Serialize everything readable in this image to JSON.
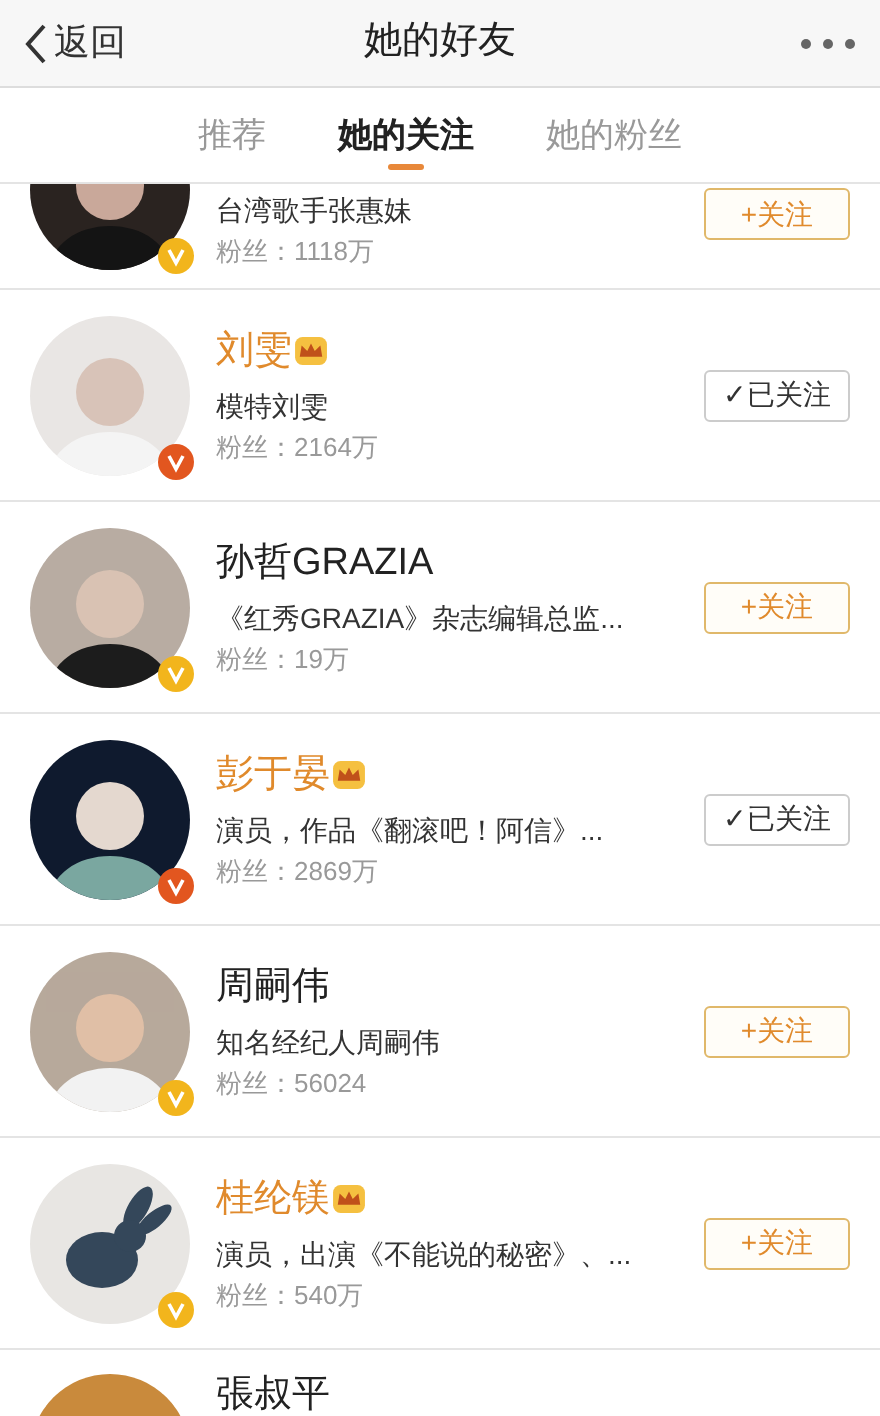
{
  "header": {
    "back": "返回",
    "title": "她的好友"
  },
  "tabs": [
    {
      "label": "推荐",
      "selected": false
    },
    {
      "label": "她的关注",
      "selected": true
    },
    {
      "label": "她的粉丝",
      "selected": false
    }
  ],
  "users": [
    {
      "description": "台湾歌手张惠妹",
      "fans": "粉丝：1118万",
      "color": "#f2b51c",
      "followed": false,
      "button": "+关注"
    },
    {
      "name": "刘雯",
      "description": "模特刘雯",
      "fans": "粉丝：2164万",
      "vip": true,
      "color": "#e2561f",
      "followed": true,
      "button": "✓已关注"
    },
    {
      "name": "孙哲GRAZIA",
      "description": "《红秀GRAZIA》杂志编辑总监...",
      "fans": "粉丝：19万",
      "vip": false,
      "color": "#f2b51c",
      "followed": false,
      "button": "+关注"
    },
    {
      "name": "彭于晏",
      "description": "演员，作品《翻滚吧！阿信》...",
      "fans": "粉丝：2869万",
      "vip": true,
      "color": "#e2561f",
      "followed": true,
      "button": "✓已关注"
    },
    {
      "name": "周嗣伟",
      "description": "知名经纪人周嗣伟",
      "fans": "粉丝：56024",
      "vip": false,
      "color": "#f2b51c",
      "followed": false,
      "button": "+关注"
    },
    {
      "name": "桂纶镁",
      "description": "演员，出演《不能说的秘密》、...",
      "fans": "粉丝：540万",
      "vip": true,
      "color": "#f2b51c",
      "followed": false,
      "button": "+关注"
    },
    {
      "name": "張叔平",
      "vip": false
    }
  ]
}
